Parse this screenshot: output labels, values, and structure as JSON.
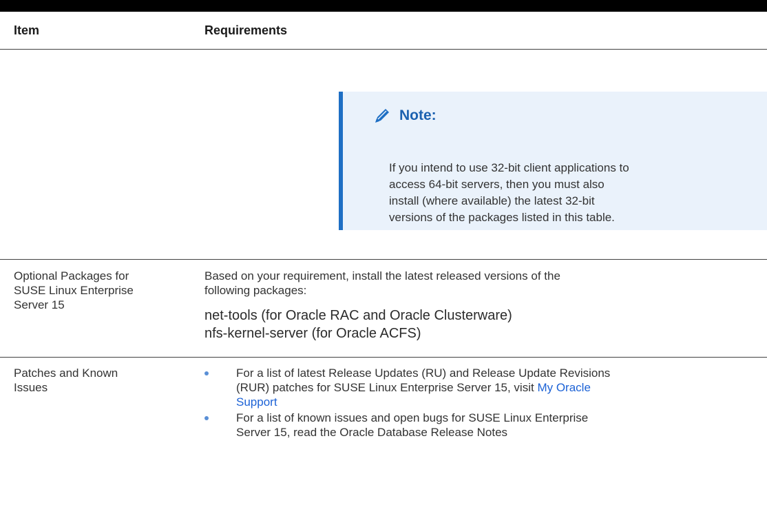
{
  "table": {
    "headers": {
      "item": "Item",
      "requirements": "Requirements"
    },
    "note": {
      "icon": "pencil-icon",
      "title": "Note:",
      "lines": [
        "If you intend to use 32-bit client applications to",
        "access 64-bit servers, then you must also",
        "install (where available) the latest 32-bit",
        "versions of the packages listed in this table."
      ]
    },
    "rows": [
      {
        "item_lines": [
          "Optional Packages for",
          "SUSE Linux Enterprise",
          "Server 15"
        ],
        "requirement_lines": [
          "Based on your requirement, install the latest released versions of the",
          "following packages:"
        ],
        "packages": [
          "net-tools (for Oracle RAC and Oracle Clusterware)",
          "nfs-kernel-server (for Oracle ACFS)"
        ]
      },
      {
        "item_lines": [
          "Patches and Known",
          "Issues"
        ],
        "bullets": [
          {
            "line1": "For a list of latest Release Updates (RU) and Release Update Revisions",
            "line2_text": "(RUR) patches for SUSE Linux Enterprise Server 15, visit ",
            "link_part1": "My Oracle",
            "link_part2": "Support"
          },
          {
            "line1": "For a list of known issues and open bugs for SUSE Linux Enterprise",
            "line2_text": "Server 15, read the Oracle Database Release Notes"
          }
        ]
      }
    ]
  },
  "colors": {
    "note_background": "#eaf2fb",
    "note_accent": "#1e6fc4",
    "link": "#1c62d6",
    "bullet": "#5a8fd6"
  }
}
